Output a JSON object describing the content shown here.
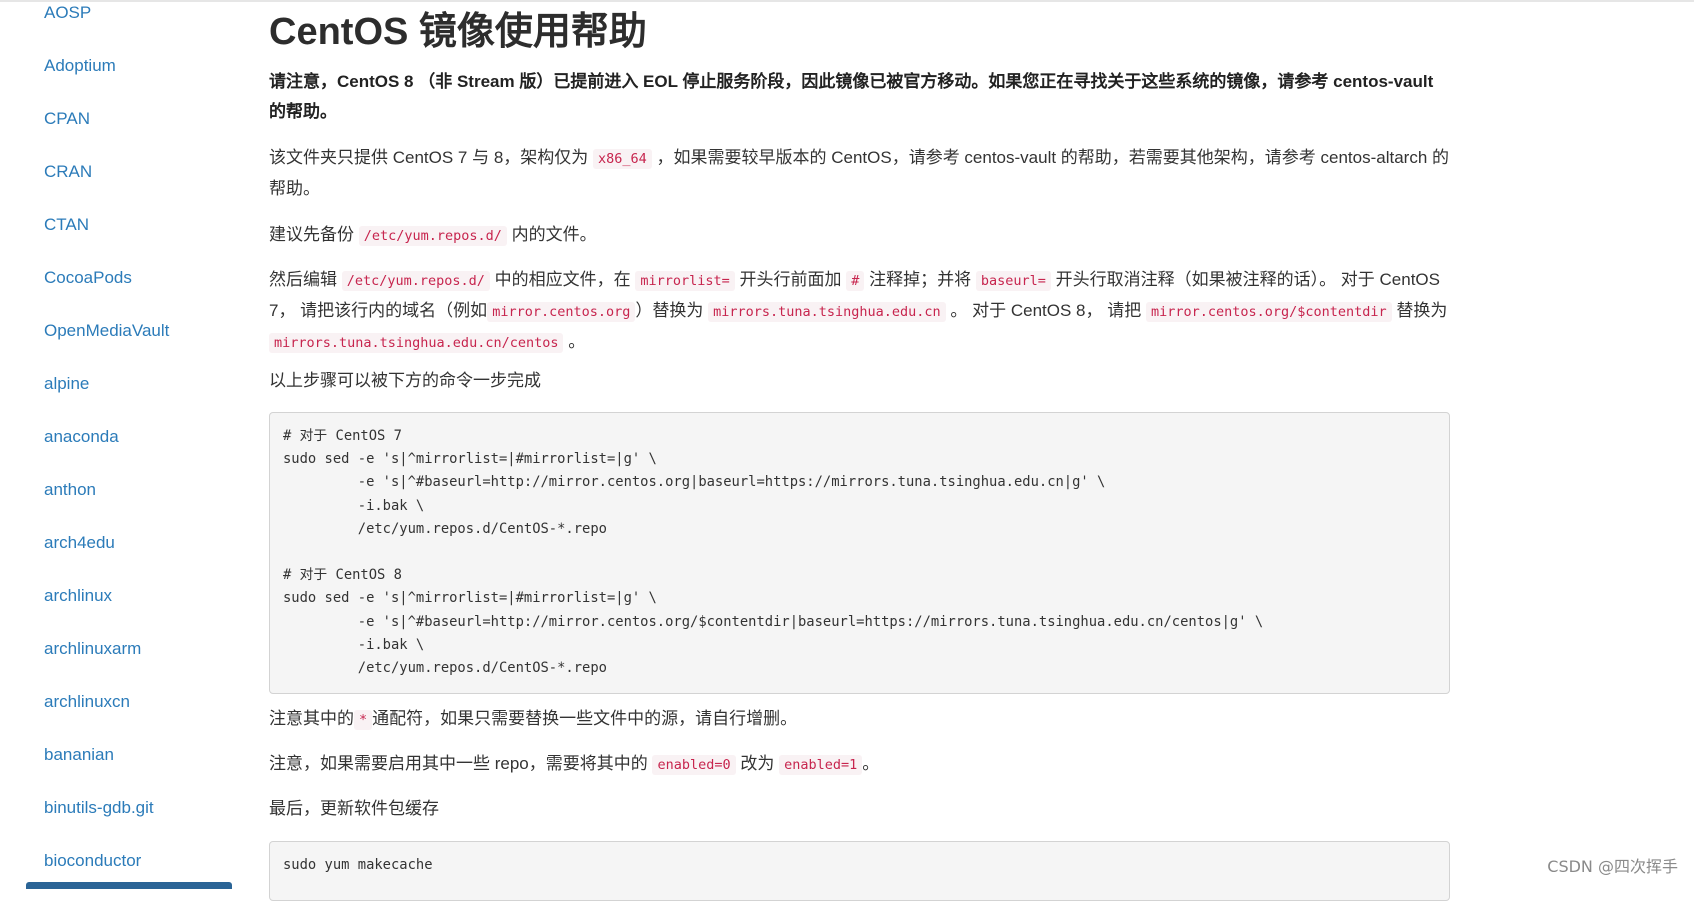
{
  "sidebar": {
    "items": [
      {
        "label": "AOSP"
      },
      {
        "label": "Adoptium"
      },
      {
        "label": "CPAN"
      },
      {
        "label": "CRAN"
      },
      {
        "label": "CTAN"
      },
      {
        "label": "CocoaPods"
      },
      {
        "label": "OpenMediaVault"
      },
      {
        "label": "alpine"
      },
      {
        "label": "anaconda"
      },
      {
        "label": "anthon"
      },
      {
        "label": "arch4edu"
      },
      {
        "label": "archlinux"
      },
      {
        "label": "archlinuxarm"
      },
      {
        "label": "archlinuxcn"
      },
      {
        "label": "bananian"
      },
      {
        "label": "binutils-gdb.git"
      },
      {
        "label": "bioconductor"
      }
    ]
  },
  "main": {
    "title": "CentOS 镜像使用帮助",
    "note": "请注意，CentOS 8 （非 Stream 版）已提前进入 EOL 停止服务阶段，因此镜像已被官方移动。如果您正在寻找关于这些系统的镜像，请参考 centos-vault 的帮助。",
    "p1": {
      "a": "该文件夹只提供 CentOS 7 与 8，架构仅为 ",
      "code": "x86_64",
      "b": " ，如果需要较早版本的 CentOS，请参考 centos-vault 的帮助，若需要其他架构，请参考 centos-altarch 的帮助。"
    },
    "p2": {
      "a": "建议先备份 ",
      "code": "/etc/yum.repos.d/",
      "b": " 内的文件。"
    },
    "p3": {
      "a": "然后编辑 ",
      "code1": "/etc/yum.repos.d/",
      "b": " 中的相应文件，在 ",
      "code2": "mirrorlist=",
      "c": " 开头行前面加 ",
      "code3": "#",
      "d": " 注释掉；并将 ",
      "code4": "baseurl=",
      "e": " 开头行取消注释（如果被注释的话）。 对于 CentOS 7， 请把该行内的域名（例如",
      "code5": "mirror.centos.org",
      "f": "）替换为 ",
      "code6": "mirrors.tuna.tsinghua.edu.cn",
      "g": " 。 对于 CentOS 8， 请把 ",
      "code7": "mirror.centos.org/$contentdir",
      "h": " 替换为 ",
      "code8": "mirrors.tuna.tsinghua.edu.cn/centos",
      "i": " 。"
    },
    "p4": "以上步骤可以被下方的命令一步完成",
    "code_block_1": "# 对于 CentOS 7\nsudo sed -e 's|^mirrorlist=|#mirrorlist=|g' \\\n         -e 's|^#baseurl=http://mirror.centos.org|baseurl=https://mirrors.tuna.tsinghua.edu.cn|g' \\\n         -i.bak \\\n         /etc/yum.repos.d/CentOS-*.repo\n\n# 对于 CentOS 8\nsudo sed -e 's|^mirrorlist=|#mirrorlist=|g' \\\n         -e 's|^#baseurl=http://mirror.centos.org/$contentdir|baseurl=https://mirrors.tuna.tsinghua.edu.cn/centos|g' \\\n         -i.bak \\\n         /etc/yum.repos.d/CentOS-*.repo",
    "p5": {
      "a": "注意其中的",
      "code": "*",
      "b": "通配符，如果只需要替换一些文件中的源，请自行增删。"
    },
    "p6": {
      "a": "注意，如果需要启用其中一些 repo，需要将其中的 ",
      "code1": "enabled=0",
      "b": " 改为 ",
      "code2": "enabled=1",
      "c": "。"
    },
    "p7": "最后，更新软件包缓存",
    "code_block_2": "sudo yum makecache"
  },
  "watermark": "CSDN @四次挥手"
}
